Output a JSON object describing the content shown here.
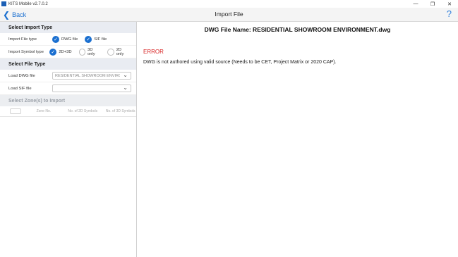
{
  "window": {
    "title": "KITS Mobile v2.7.0.2",
    "minimize": "—",
    "restore": "❐",
    "close": "✕"
  },
  "header": {
    "back_label": "Back",
    "title": "Import File",
    "help": "?"
  },
  "left": {
    "import_type": {
      "heading": "Select Import Type",
      "file_type_label": "Import File type",
      "file_types": [
        {
          "label": "DWG file",
          "checked": true
        },
        {
          "label": "SIF file",
          "checked": true
        }
      ],
      "symbol_type_label": "Import Symbol type",
      "symbol_types": [
        {
          "label": "2D+3D",
          "checked": true
        },
        {
          "label": "3D only",
          "checked": false
        },
        {
          "label": "2D only",
          "checked": false
        }
      ]
    },
    "file_type": {
      "heading": "Select File Type",
      "dwg_label": "Load DWG file",
      "dwg_value": "RESIDENTIAL SHOWROOM ENVIRO...",
      "sif_label": "Load SIF file",
      "sif_value": ""
    },
    "zones": {
      "heading": "Select Zone(s) to Import",
      "columns": [
        "Zone No.",
        "No. of 2D Symbols",
        "No. of 3D Symbols"
      ]
    }
  },
  "right": {
    "file_title": "DWG File Name: RESIDENTIAL SHOWROOM ENVIRONMENT.dwg",
    "error_label": "ERROR",
    "error_message": "DWG is not authored using valid source (Needs to be CET, Project Matrix or 2020 CAP)."
  },
  "colors": {
    "accent": "#1a6fd0",
    "error": "#d61f1f",
    "section_bg": "#e9ecf2"
  }
}
